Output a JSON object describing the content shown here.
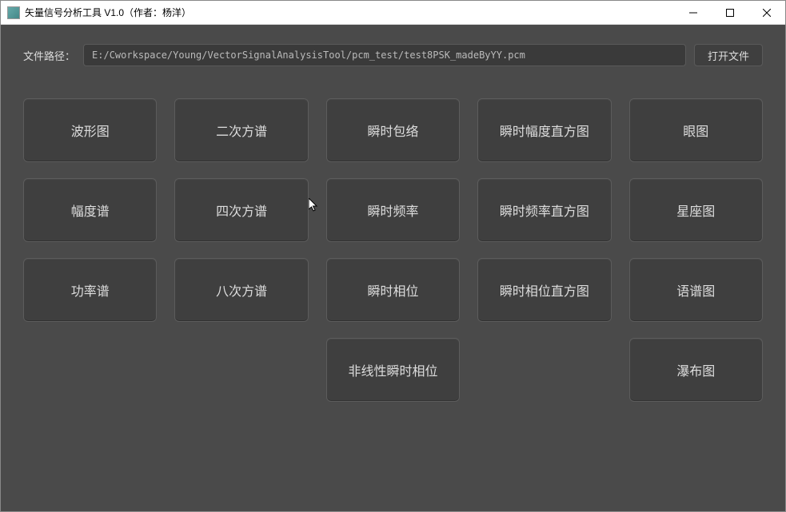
{
  "window": {
    "title": "矢量信号分析工具 V1.0（作者：杨洋）"
  },
  "file": {
    "label": "文件路径：",
    "path": "E:/Cworkspace/Young/VectorSignalAnalysisTool/pcm_test/test8PSK_madeByYY.pcm",
    "open_label": "打开文件"
  },
  "tiles": {
    "r0c0": "波形图",
    "r0c1": "二次方谱",
    "r0c2": "瞬时包络",
    "r0c3": "瞬时幅度直方图",
    "r0c4": "眼图",
    "r1c0": "幅度谱",
    "r1c1": "四次方谱",
    "r1c2": "瞬时频率",
    "r1c3": "瞬时频率直方图",
    "r1c4": "星座图",
    "r2c0": "功率谱",
    "r2c1": "八次方谱",
    "r2c2": "瞬时相位",
    "r2c3": "瞬时相位直方图",
    "r2c4": "语谱图",
    "r3c2": "非线性瞬时相位",
    "r3c4": "瀑布图"
  }
}
